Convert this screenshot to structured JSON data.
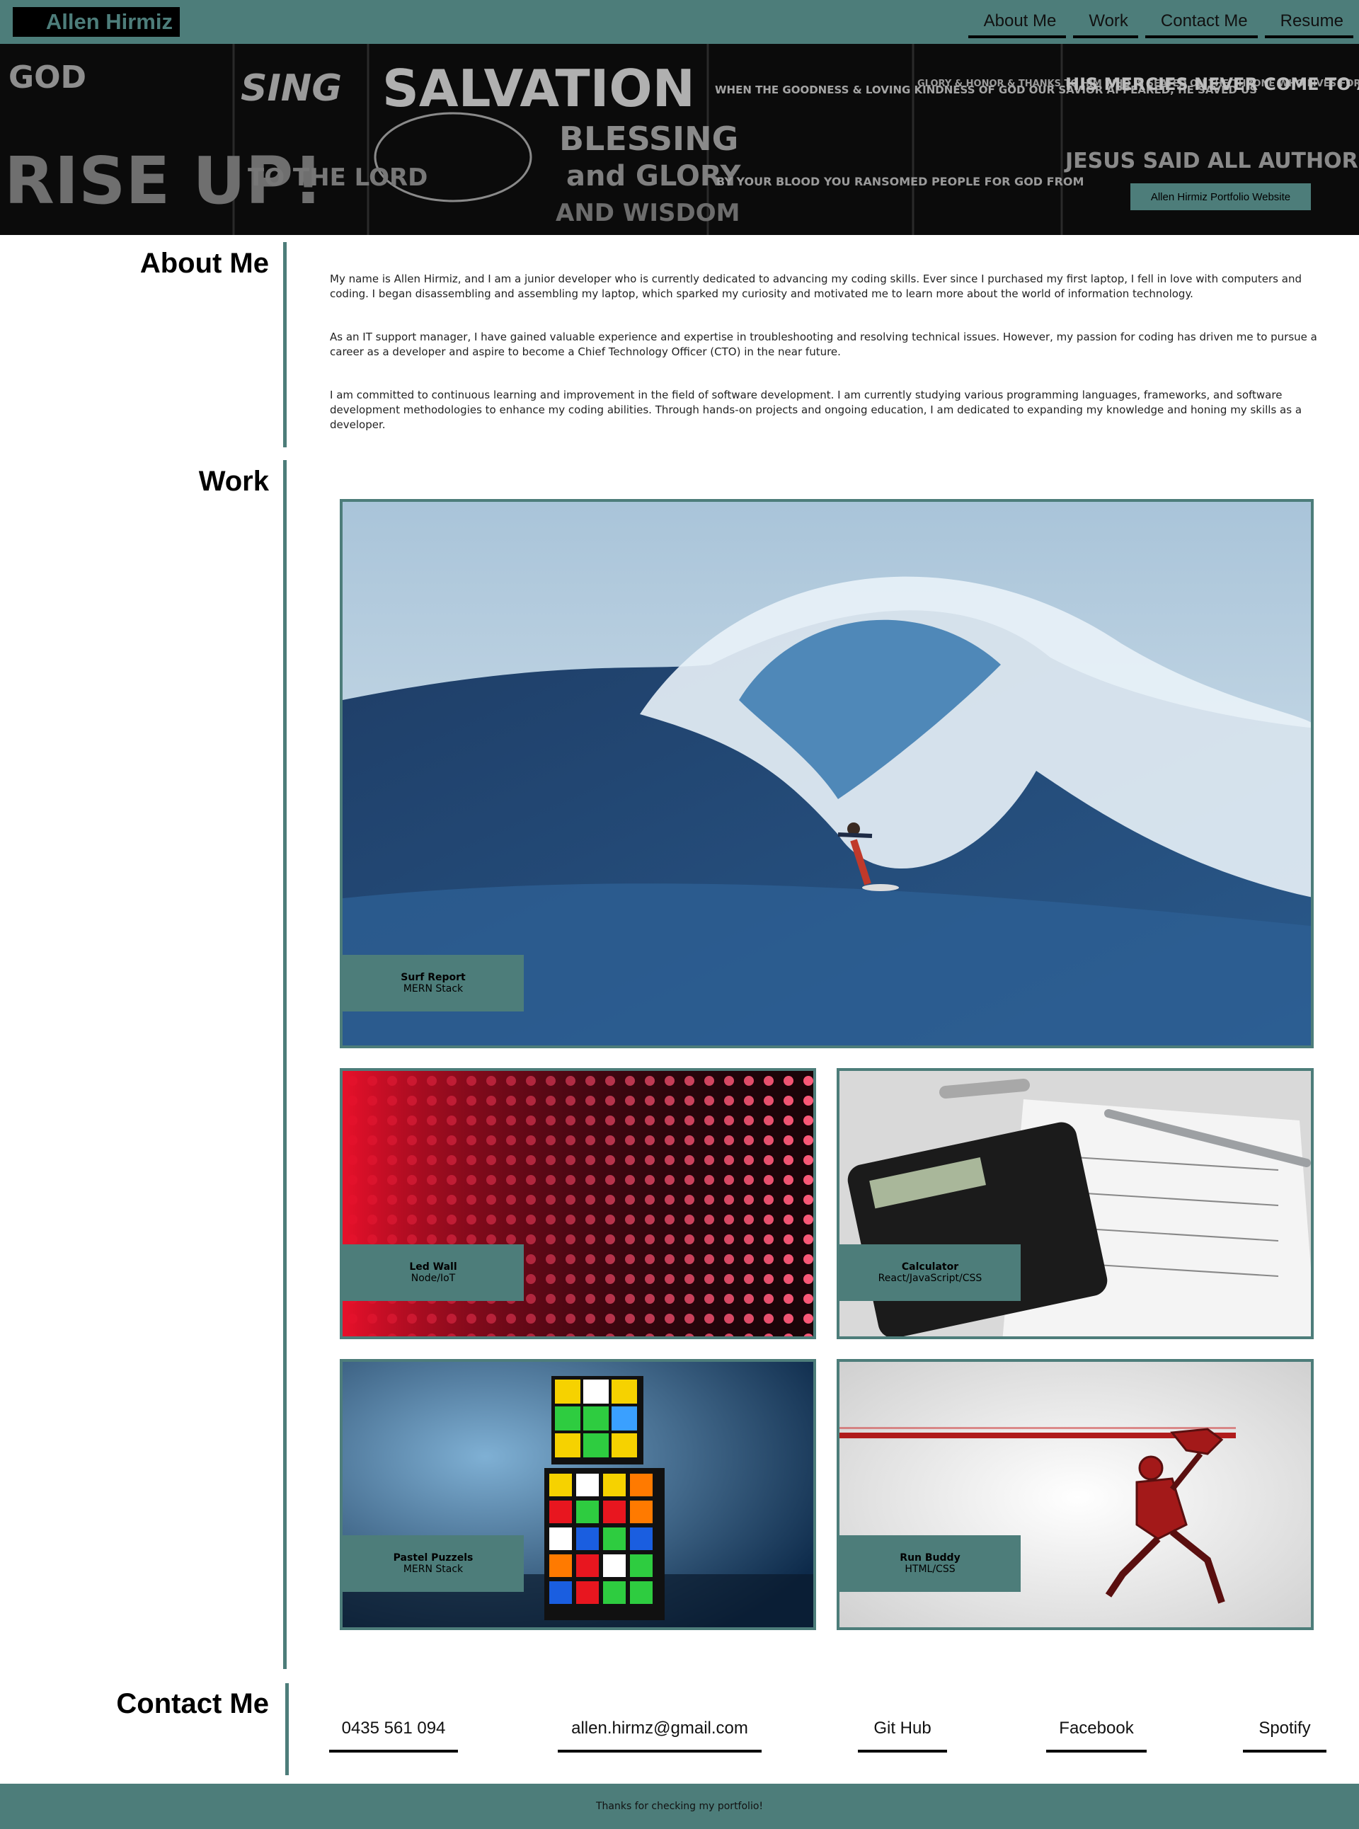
{
  "header": {
    "brand": "Allen Hirmiz",
    "nav": [
      "About Me",
      "Work",
      "Contact Me",
      "Resume"
    ]
  },
  "hero": {
    "badge": "Allen Hirmiz Portfolio Website",
    "lettering": [
      "GOD",
      "RISE UP!",
      "SING",
      "TO THE LORD",
      "SALVATION",
      "BLESSING",
      "and GLORY",
      "AND WISDOM",
      "WHEN THE GOODNESS & LOVING KINDNESS OF GOD OUR SAVIOR APPEARED, HE SAVED US",
      "BY YOUR BLOOD YOU RANSOMED PEOPLE FOR GOD FROM",
      "GLORY & HONOR & THANKS TO HIM WHO IS SEATED ON THE THRONE WHO LIVES FOREVER & EVER",
      "HIS MERCIES NEVER COME TO AN END",
      "JESUS SAID ALL AUTHORITY"
    ]
  },
  "about": {
    "title": "About Me",
    "paragraphs": [
      "My name is Allen Hirmiz, and I am a junior developer who is currently dedicated to advancing my coding skills. Ever since I purchased my first laptop, I fell in love with computers and coding. I began disassembling and assembling my laptop, which sparked my curiosity and motivated me to learn more about the world of information technology.",
      "As an IT support manager, I have gained valuable experience and expertise in troubleshooting and resolving technical issues. However, my passion for coding has driven me to pursue a career as a developer and aspire to become a Chief Technology Officer (CTO) in the near future.",
      "I am committed to continuous learning and improvement in the field of software development. I am currently studying various programming languages, frameworks, and software development methodologies to enhance my coding abilities. Through hands-on projects and ongoing education, I am dedicated to expanding my knowledge and honing my skills as a developer."
    ]
  },
  "work": {
    "title": "Work",
    "projects": [
      {
        "name": "Surf Report",
        "stack": "MERN Stack",
        "image": "surfer-wave-image"
      },
      {
        "name": "Led Wall",
        "stack": "Node/IoT",
        "image": "led-wall-image"
      },
      {
        "name": "Calculator",
        "stack": "React/JavaScript/CSS",
        "image": "calculator-image"
      },
      {
        "name": "Pastel Puzzels",
        "stack": "MERN Stack",
        "image": "rubiks-cube-image"
      },
      {
        "name": "Run Buddy",
        "stack": "HTML/CSS",
        "image": "iron-man-image"
      }
    ]
  },
  "contact": {
    "title": "Contact Me",
    "items": [
      "0435 561 094",
      "allen.hirmz@gmail.com",
      "Git Hub",
      "Facebook",
      "Spotify"
    ]
  },
  "footer": {
    "text": "Thanks for checking my portfolio!"
  },
  "colors": {
    "accent": "#4d7d7a",
    "hero_bg": "#0b0b0b",
    "text": "#111111"
  }
}
